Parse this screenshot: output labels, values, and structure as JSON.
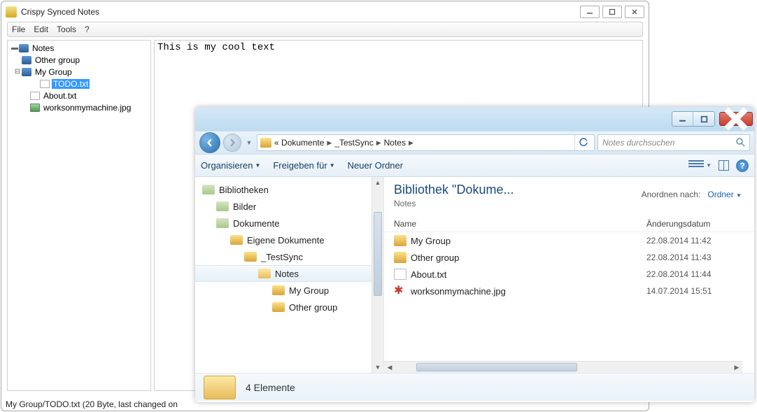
{
  "app": {
    "title": "Crispy Synced Notes",
    "menu": [
      "File",
      "Edit",
      "Tools",
      "?"
    ],
    "tree": {
      "root": "Notes",
      "items": [
        {
          "label": "Other group",
          "type": "folder",
          "indent": 1
        },
        {
          "label": "My Group",
          "type": "folder",
          "indent": 1,
          "expanded": true
        },
        {
          "label": "TODO.txt",
          "type": "file",
          "indent": 2,
          "selected": true
        },
        {
          "label": "About.txt",
          "type": "file",
          "indent": 1
        },
        {
          "label": "worksonmymachine.jpg",
          "type": "image",
          "indent": 1
        }
      ]
    },
    "editor_text": "This is my cool text",
    "statusbar": "My Group/TODO.txt (20 Byte, last changed on"
  },
  "explorer": {
    "breadcrumb_prefix": "«",
    "breadcrumb": [
      "Dokumente",
      "_TestSync",
      "Notes"
    ],
    "search_placeholder": "Notes durchsuchen",
    "toolbar": {
      "organize": "Organisieren",
      "share": "Freigeben für",
      "newfolder": "Neuer Ordner"
    },
    "nav_tree": [
      {
        "label": "Bibliotheken",
        "icon": "lib",
        "indent": 0
      },
      {
        "label": "Bilder",
        "icon": "lib",
        "indent": 1
      },
      {
        "label": "Dokumente",
        "icon": "lib",
        "indent": 1
      },
      {
        "label": "Eigene Dokumente",
        "icon": "folder",
        "indent": 2
      },
      {
        "label": "_TestSync",
        "icon": "folder",
        "indent": 3
      },
      {
        "label": "Notes",
        "icon": "folder-open",
        "indent": 4,
        "selected": true
      },
      {
        "label": "My Group",
        "icon": "folder",
        "indent": 5
      },
      {
        "label": "Other group",
        "icon": "folder",
        "indent": 5
      }
    ],
    "header": {
      "title": "Bibliothek \"Dokume...",
      "subtitle": "Notes",
      "arrange_label": "Anordnen nach:",
      "arrange_value": "Ordner"
    },
    "columns": {
      "name": "Name",
      "date": "Änderungsdatum"
    },
    "files": [
      {
        "name": "My Group",
        "type": "folder",
        "date": "22.08.2014 11:42"
      },
      {
        "name": "Other group",
        "type": "folder",
        "date": "22.08.2014 11:43"
      },
      {
        "name": "About.txt",
        "type": "txt",
        "date": "22.08.2014 11:44"
      },
      {
        "name": "worksonmymachine.jpg",
        "type": "jpg",
        "date": "14.07.2014 15:51"
      }
    ],
    "status": "4 Elemente"
  }
}
